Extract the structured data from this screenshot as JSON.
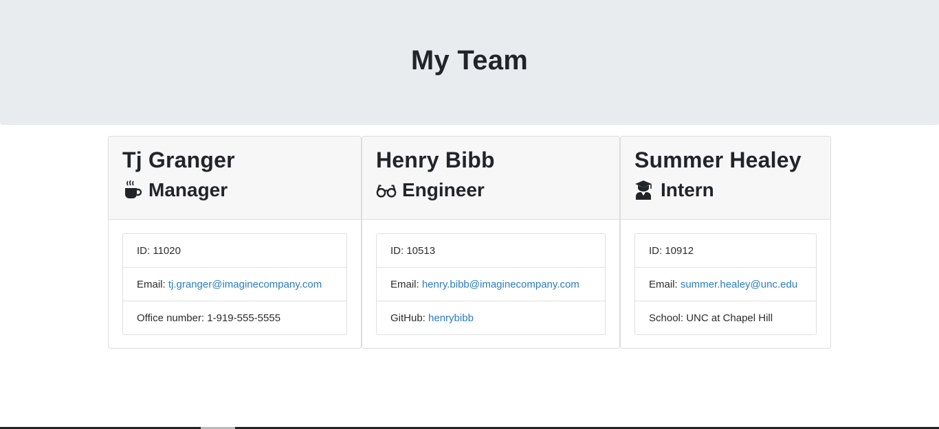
{
  "header": {
    "title": "My Team"
  },
  "cards": [
    {
      "name": "Tj Granger",
      "role": "Manager",
      "icon": "coffee-icon",
      "items": [
        {
          "label": "ID: ",
          "value": "11020"
        },
        {
          "label": "Email: ",
          "value": "tj.granger@imaginecompany.com"
        },
        {
          "label": "Office number: ",
          "value": "1-919-555-5555"
        }
      ]
    },
    {
      "name": "Henry Bibb",
      "role": "Engineer",
      "icon": "glasses-icon",
      "items": [
        {
          "label": "ID: ",
          "value": "10513"
        },
        {
          "label": "Email: ",
          "value": "henry.bibb@imaginecompany.com"
        },
        {
          "label": "GitHub: ",
          "value": "henrybibb"
        }
      ]
    },
    {
      "name": "Summer Healey",
      "role": "Intern",
      "icon": "graduate-icon",
      "items": [
        {
          "label": "ID: ",
          "value": "10912"
        },
        {
          "label": "Email: ",
          "value": "summer.healey@unc.edu"
        },
        {
          "label": "School: ",
          "value": "UNC at Chapel Hill"
        }
      ]
    }
  ],
  "colors": {
    "header_bg": "#e9ecef",
    "link": "#2a7bc2",
    "card_header_bg": "#f7f7f7"
  }
}
